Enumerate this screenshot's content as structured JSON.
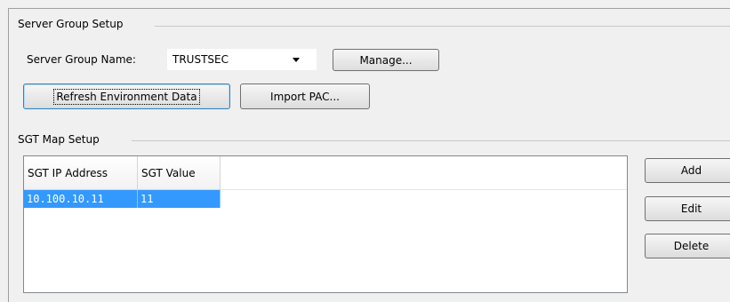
{
  "server_group_setup": {
    "title": "Server Group Setup",
    "group_name_label": "Server Group Name:",
    "group_name_value": "TRUSTSEC",
    "manage_label": "Manage...",
    "refresh_label": "Refresh Environment Data",
    "import_pac_label": "Import PAC..."
  },
  "sgt_map_setup": {
    "title": "SGT Map Setup",
    "columns": [
      "SGT IP Address",
      "SGT Value"
    ],
    "rows": [
      {
        "ip": "10.100.10.11",
        "value": "11",
        "selected": true
      }
    ],
    "add_label": "Add",
    "edit_label": "Edit",
    "delete_label": "Delete"
  },
  "colors": {
    "selection": "#3399ff",
    "background": "#f0f0f0"
  }
}
